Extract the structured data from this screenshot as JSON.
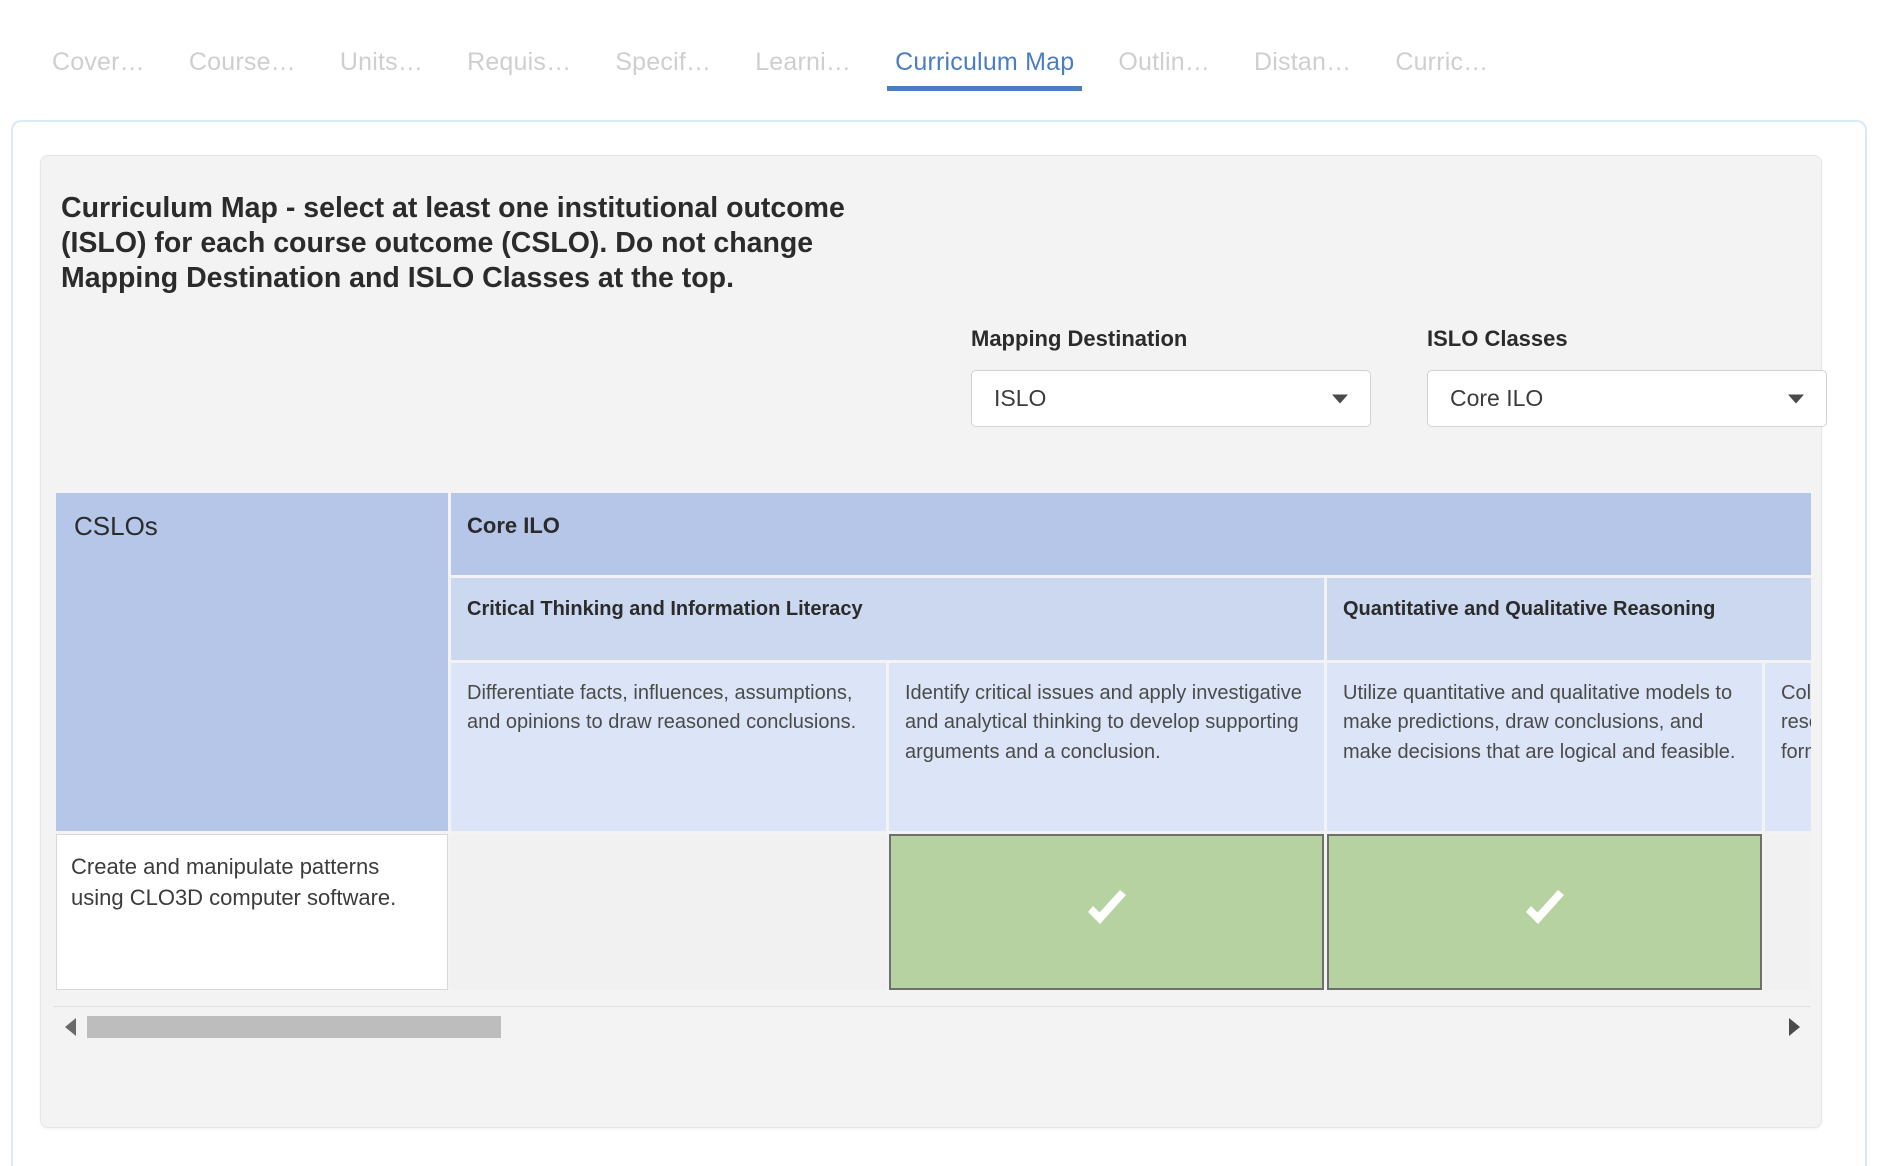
{
  "tabs": [
    {
      "label": "Cover…",
      "active": false
    },
    {
      "label": "Course…",
      "active": false
    },
    {
      "label": "Units…",
      "active": false
    },
    {
      "label": "Requis…",
      "active": false
    },
    {
      "label": "Specif…",
      "active": false
    },
    {
      "label": "Learni…",
      "active": false
    },
    {
      "label": "Curriculum Map",
      "active": true
    },
    {
      "label": "Outlin…",
      "active": false
    },
    {
      "label": "Distan…",
      "active": false
    },
    {
      "label": "Curric…",
      "active": false
    }
  ],
  "panel": {
    "heading": "Curriculum Map - select at least one institutional outcome (ISLO) for each course outcome (CSLO). Do not change Mapping Destination and ISLO Classes at the top."
  },
  "selects": {
    "mapping_destination": {
      "label": "Mapping Destination",
      "value": "ISLO",
      "arrow_icon": "chevron-down-icon"
    },
    "islo_classes": {
      "label": "ISLO Classes",
      "value": "Core ILO",
      "arrow_icon": "chevron-down-icon"
    }
  },
  "table": {
    "cslo_header": "CSLOs",
    "group_header": "Core ILO",
    "categories": [
      {
        "label": "Critical Thinking and Information Literacy",
        "span": 2
      },
      {
        "label": "Quantitative and Qualitative Reasoning",
        "span": 2
      }
    ],
    "outcomes": [
      "Differentiate facts, influences, assumptions, and opinions to draw reasoned conclusions.",
      "Identify critical issues and apply investigative and analytical thinking to develop supporting arguments and a conclusion.",
      "Utilize quantitative and qualitative models to make predictions, draw conclusions, and make decisions that are logical and feasible.",
      "Collect, organize, analyze and process research data in a clear and synthesized format."
    ],
    "rows": [
      {
        "cslo": "Create and manipulate patterns using CLO3D computer software.",
        "marks": [
          false,
          true,
          true,
          false
        ]
      }
    ]
  },
  "scrollbar": {
    "left_arrow_icon": "triangle-left-icon",
    "right_arrow_icon": "triangle-right-icon",
    "thumb_position_percent": 0,
    "thumb_width_percent": 24.5
  },
  "colors": {
    "accent": "#4a7ec4",
    "header_blue": "#b5c6e8",
    "subheader_blue": "#cbd8f0",
    "desc_blue": "#dce5f7",
    "checked_green": "#b5d2a0",
    "panel_grey": "#f3f3f3",
    "outer_border_blue": "#d7eaf5"
  }
}
